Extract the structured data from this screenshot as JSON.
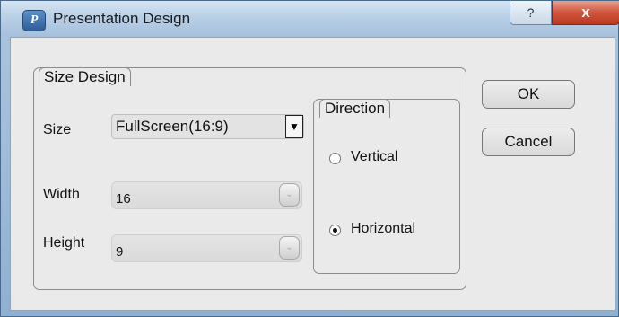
{
  "window": {
    "title": "Presentation Design",
    "app_icon_glyph": "P",
    "help_label": "?",
    "close_label": "x"
  },
  "size_design": {
    "legend": "Size Design",
    "size_label": "Size",
    "size_value": "FullScreen(16:9)",
    "width_label": "Width",
    "width_value": "16",
    "height_label": "Height",
    "height_value": "9"
  },
  "direction": {
    "legend": "Direction",
    "vertical_label": "Vertical",
    "horizontal_label": "Horizontal",
    "selected": "Horizontal"
  },
  "buttons": {
    "ok": "OK",
    "cancel": "Cancel"
  },
  "glyphs": {
    "dropdown_arrow": "▼",
    "spin_arrow": "⌄"
  }
}
